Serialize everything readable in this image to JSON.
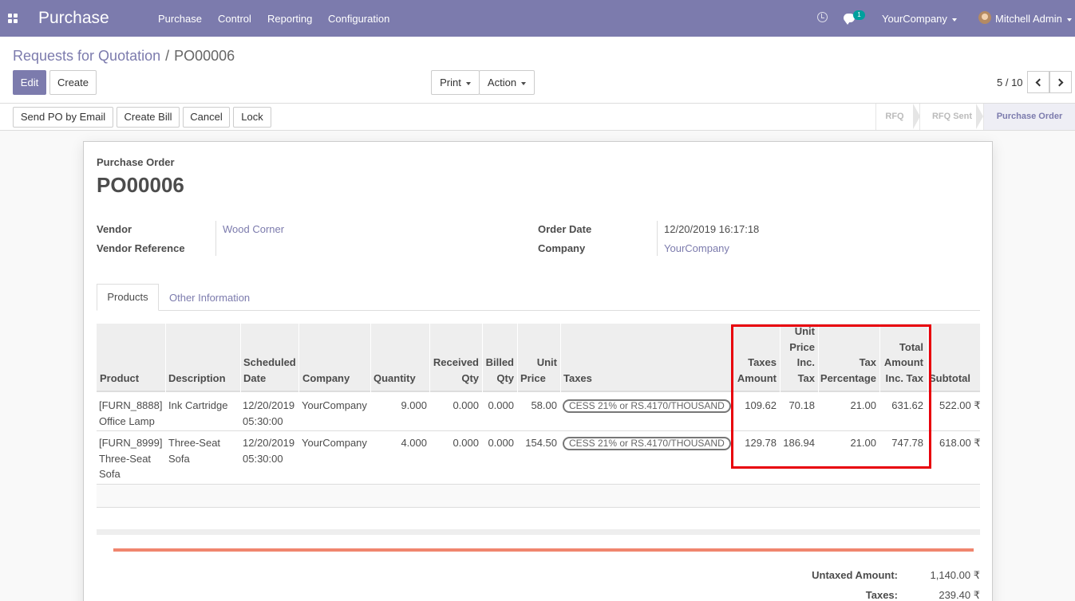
{
  "nav": {
    "app_title": "Purchase",
    "menus": [
      "Purchase",
      "Control",
      "Reporting",
      "Configuration"
    ],
    "notification_count": "1",
    "company": "YourCompany",
    "user": "Mitchell Admin"
  },
  "breadcrumb": {
    "parent": "Requests for Quotation",
    "sep": "/",
    "current": "PO00006"
  },
  "toolbar": {
    "edit": "Edit",
    "create": "Create",
    "print": "Print",
    "action": "Action"
  },
  "pager": {
    "value": "5 / 10"
  },
  "status_buttons": [
    "Send PO by Email",
    "Create Bill",
    "Cancel",
    "Lock"
  ],
  "stages": [
    "RFQ",
    "RFQ Sent",
    "Purchase Order"
  ],
  "form": {
    "doc_type": "Purchase Order",
    "name": "PO00006",
    "vendor_label": "Vendor",
    "vendor": "Wood Corner",
    "vendor_ref_label": "Vendor Reference",
    "order_date_label": "Order Date",
    "order_date": "12/20/2019 16:17:18",
    "company_label": "Company",
    "company": "YourCompany"
  },
  "tabs": [
    "Products",
    "Other Information"
  ],
  "table": {
    "headers": {
      "product": "Product",
      "description": "Description",
      "sched_1": "Scheduled",
      "sched_2": "Date",
      "company": "Company",
      "quantity": "Quantity",
      "received_1": "Received",
      "received_2": "Qty",
      "billed_1": "Billed",
      "billed_2": "Qty",
      "unit_price_1": "Unit",
      "unit_price_2": "Price",
      "taxes": "Taxes",
      "taxes_amount_1": "Taxes",
      "taxes_amount_2": "Amount",
      "upit_1": "Unit",
      "upit_2": "Price",
      "upit_3": "Inc.",
      "upit_4": "Tax",
      "tax_pct_1": "Tax",
      "tax_pct_2": "Percentage",
      "total_1": "Total",
      "total_2": "Amount",
      "total_3": "Inc. Tax",
      "subtotal": "Subtotal"
    },
    "rows": [
      {
        "product_1": "[FURN_8888]",
        "product_2": "Office Lamp",
        "product_3": "",
        "description_1": "Ink Cartridge",
        "description_2": "",
        "date_1": "12/20/2019",
        "date_2": "05:30:00",
        "company": "YourCompany",
        "quantity": "9.000",
        "received": "0.000",
        "billed": "0.000",
        "unit_price": "58.00",
        "tax": "CESS 21% or RS.4170/THOUSAND",
        "taxes_amount": "109.62",
        "unit_price_inc_tax": "70.18",
        "tax_percentage": "21.00",
        "total_inc_tax": "631.62",
        "subtotal": "522.00 ₹"
      },
      {
        "product_1": "[FURN_8999]",
        "product_2": "Three-Seat",
        "product_3": "Sofa",
        "description_1": "Three-Seat",
        "description_2": "Sofa",
        "date_1": "12/20/2019",
        "date_2": "05:30:00",
        "company": "YourCompany",
        "quantity": "4.000",
        "received": "0.000",
        "billed": "0.000",
        "unit_price": "154.50",
        "tax": "CESS 21% or RS.4170/THOUSAND",
        "taxes_amount": "129.78",
        "unit_price_inc_tax": "186.94",
        "tax_percentage": "21.00",
        "total_inc_tax": "747.78",
        "subtotal": "618.00 ₹"
      }
    ]
  },
  "totals": {
    "untaxed_label": "Untaxed Amount:",
    "untaxed": "1,140.00 ₹",
    "taxes_label": "Taxes:",
    "taxes": "239.40 ₹"
  },
  "colors": {
    "brand": "#7c7bad",
    "highlight": "#e8000b",
    "accent_line": "#f0856e"
  }
}
